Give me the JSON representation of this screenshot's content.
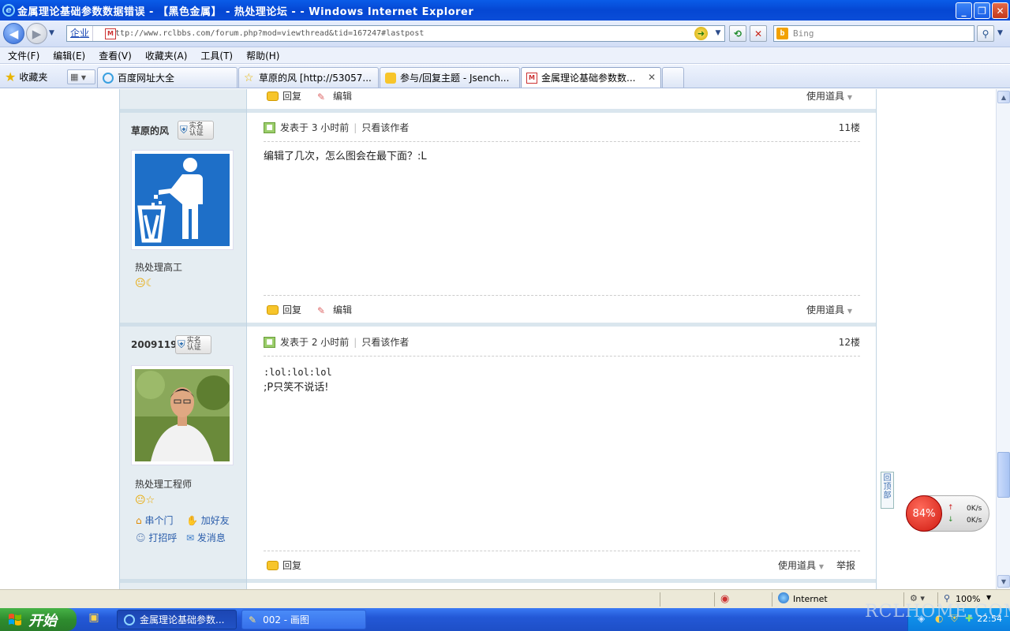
{
  "window": {
    "title": "金属理论基础参数数据错误 - 【黑色金属】 - 热处理论坛 - - Windows Internet Explorer",
    "btn_min": "_",
    "btn_max": "❐",
    "btn_close": "✕"
  },
  "address": {
    "zone": "企业",
    "url": "http://www.rclbbs.com/forum.php?mod=viewthread&tid=167247#lastpost",
    "search_placeholder": "Bing"
  },
  "menu": [
    "文件(F)",
    "编辑(E)",
    "查看(V)",
    "收藏夹(A)",
    "工具(T)",
    "帮助(H)"
  ],
  "favorites": {
    "label": "收藏夹"
  },
  "tabs": [
    {
      "label": "百度网址大全"
    },
    {
      "label": "草原的风 [http://53057..."
    },
    {
      "label": "参与/回复主题 - Jsench..."
    },
    {
      "label": "金属理论基础参数数...",
      "close": "✕"
    }
  ],
  "posts": [
    {
      "top_actions": {
        "reply": "回复",
        "edit": "编辑",
        "tools": "使用道具"
      }
    },
    {
      "author": "草原的风",
      "badge": "实名认证",
      "rank": "热处理高工",
      "medals": "😐☾",
      "meta": "发表于 3 小时前",
      "only_author": "只看该作者",
      "floor": "11楼",
      "body": "编辑了几次，怎么图会在最下面？:L",
      "actions": {
        "reply": "回复",
        "edit": "编辑",
        "tools": "使用道具"
      }
    },
    {
      "author": "2009119",
      "badge": "实名认证",
      "rank": "热处理工程师",
      "medals": "😐☆",
      "links": {
        "visit": "串个门",
        "add_friend": "加好友",
        "greet": "打招呼",
        "message": "发消息"
      },
      "meta": "发表于 2 小时前",
      "only_author": "只看该作者",
      "floor": "12楼",
      "body_line1": ":lol:lol:lol",
      "body_line2": ";P只笑不说话!",
      "actions": {
        "reply": "回复",
        "tools": "使用道具",
        "report": "举报"
      }
    }
  ],
  "backtop": "回\n顶\n部",
  "net_widget": {
    "percent": "84%",
    "up": "0K/s",
    "down": "0K/s"
  },
  "status": {
    "zone": "Internet",
    "zoom": "100%"
  },
  "taskbar": {
    "start": "开始",
    "items": [
      {
        "label": "金属理论基础参数..."
      },
      {
        "label": "002 - 画图"
      }
    ],
    "clock": "22:54"
  },
  "watermark": "RCLHOME.COM"
}
